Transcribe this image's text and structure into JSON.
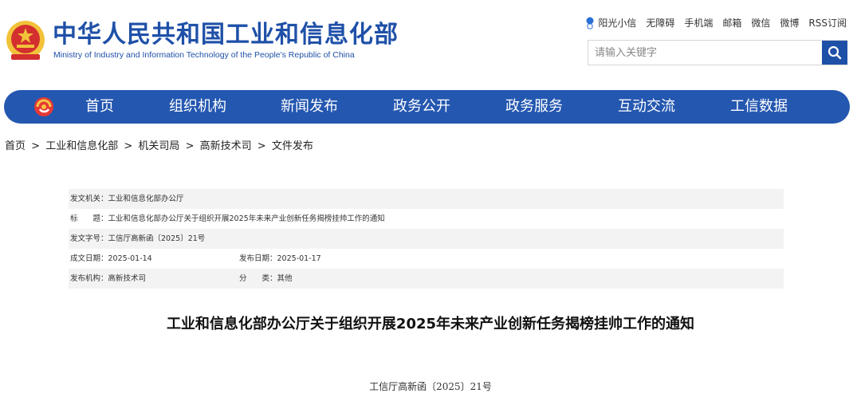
{
  "header": {
    "site_name_cn": "中华人民共和国工业和信息化部",
    "site_name_en": "Ministry of Industry and Information Technology of the People's Republic of China",
    "top_links": [
      "阳光小信",
      "无障碍",
      "手机端",
      "邮箱",
      "微信",
      "微博",
      "RSS订阅"
    ],
    "search_placeholder": "请输入关键字"
  },
  "nav": {
    "items": [
      "首页",
      "组织机构",
      "新闻发布",
      "政务公开",
      "政务服务",
      "互动交流",
      "工信数据"
    ]
  },
  "breadcrumb": [
    "首页",
    ">",
    "工业和信息化部",
    ">",
    "机关司局",
    ">",
    "高新技术司",
    ">",
    "文件发布"
  ],
  "meta": {
    "issuer_label": "发文机关：",
    "issuer": "工业和信息化部办公厅",
    "title_label": "标　　题：",
    "title": "工业和信息化部办公厅关于组织开展2025年未来产业创新任务揭榜挂帅工作的通知",
    "doc_no_label": "发文字号：",
    "doc_no": "工信厅高新函〔2025〕21号",
    "date_label": "成文日期：",
    "date": "2025-01-14",
    "pub_label": "发布日期：",
    "pub_date": "2025-01-17",
    "org_label": "发布机构：",
    "org": "高新技术司",
    "cat_label": "分　　类：",
    "category": "其他"
  },
  "document": {
    "title": "工业和信息化部办公厅关于组织开展2025年未来产业创新任务揭榜挂帅工作的通知",
    "number": "工信厅高新函〔2025〕21号"
  },
  "colors": {
    "brand": "#1f50a8",
    "nav": "#2457b0",
    "emblem_red": "#d32f2f",
    "emblem_gold": "#f2c23a"
  }
}
